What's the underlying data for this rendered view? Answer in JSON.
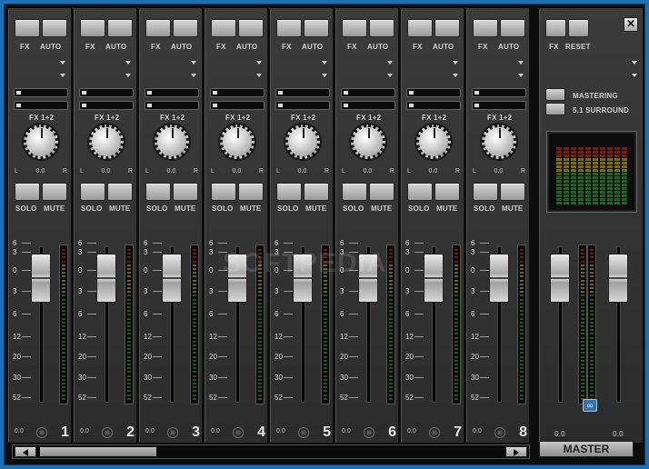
{
  "channel_labels": {
    "fx": "FX",
    "auto": "AUTO",
    "fx12": "FX 1+2",
    "pan_l": "L",
    "pan_r": "R",
    "solo": "SOLO",
    "mute": "MUTE"
  },
  "channels": [
    {
      "number": "1",
      "pan": "0.0",
      "level": "0.0"
    },
    {
      "number": "2",
      "pan": "0.0",
      "level": "0.0"
    },
    {
      "number": "3",
      "pan": "0.0",
      "level": "0.0"
    },
    {
      "number": "4",
      "pan": "0.0",
      "level": "0.0"
    },
    {
      "number": "5",
      "pan": "0.0",
      "level": "0.0"
    },
    {
      "number": "6",
      "pan": "0.0",
      "level": "0.0"
    },
    {
      "number": "7",
      "pan": "0.0",
      "level": "0.0"
    },
    {
      "number": "8",
      "pan": "0.0",
      "level": "0.0"
    }
  ],
  "fader_scale": [
    "6",
    "3",
    "0",
    "3",
    "6",
    "12",
    "20",
    "30",
    "52"
  ],
  "master": {
    "fx": "FX",
    "reset": "RESET",
    "mastering": "MASTERING",
    "surround": "5.1 SURROUND",
    "left_level": "0.0",
    "right_level": "0.0",
    "link_icon": "∞",
    "close": "✕",
    "label": "MASTER"
  },
  "watermark": "SOFTPEDIA",
  "colors": {
    "meter_green": "#2f9e2f",
    "meter_yellow": "#c6b21a",
    "meter_red": "#c42a1a",
    "window_bg": "#1a6fb5"
  }
}
